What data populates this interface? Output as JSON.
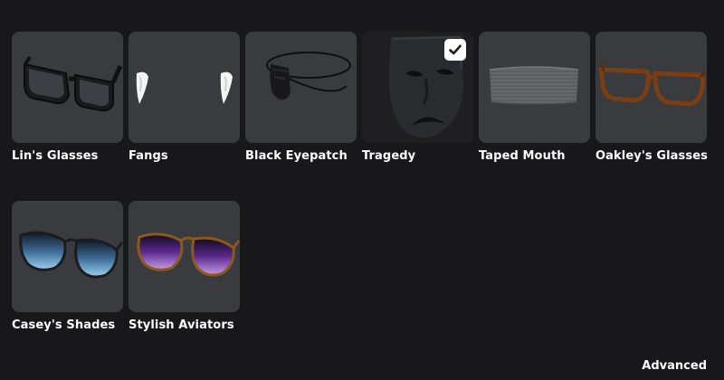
{
  "items": [
    {
      "label": "Lin's Glasses",
      "icon": "lins-glasses-icon",
      "selected": false
    },
    {
      "label": "Fangs",
      "icon": "fangs-icon",
      "selected": false
    },
    {
      "label": "Black Eyepatch",
      "icon": "black-eyepatch-icon",
      "selected": false
    },
    {
      "label": "Tragedy",
      "icon": "tragedy-mask-icon",
      "selected": true
    },
    {
      "label": "Taped Mouth",
      "icon": "taped-mouth-icon",
      "selected": false
    },
    {
      "label": "Oakley's Glasses",
      "icon": "oakleys-glasses-icon",
      "selected": false
    },
    {
      "label": "Casey's Shades",
      "icon": "caseys-shades-icon",
      "selected": false
    },
    {
      "label": "Stylish Aviators",
      "icon": "stylish-aviators-icon",
      "selected": false
    }
  ],
  "advanced_label": "Advanced",
  "colors": {
    "background": "#18181a",
    "tile": "#393b3f",
    "tile_selected": "#1f1f22",
    "text": "#ffffff"
  }
}
